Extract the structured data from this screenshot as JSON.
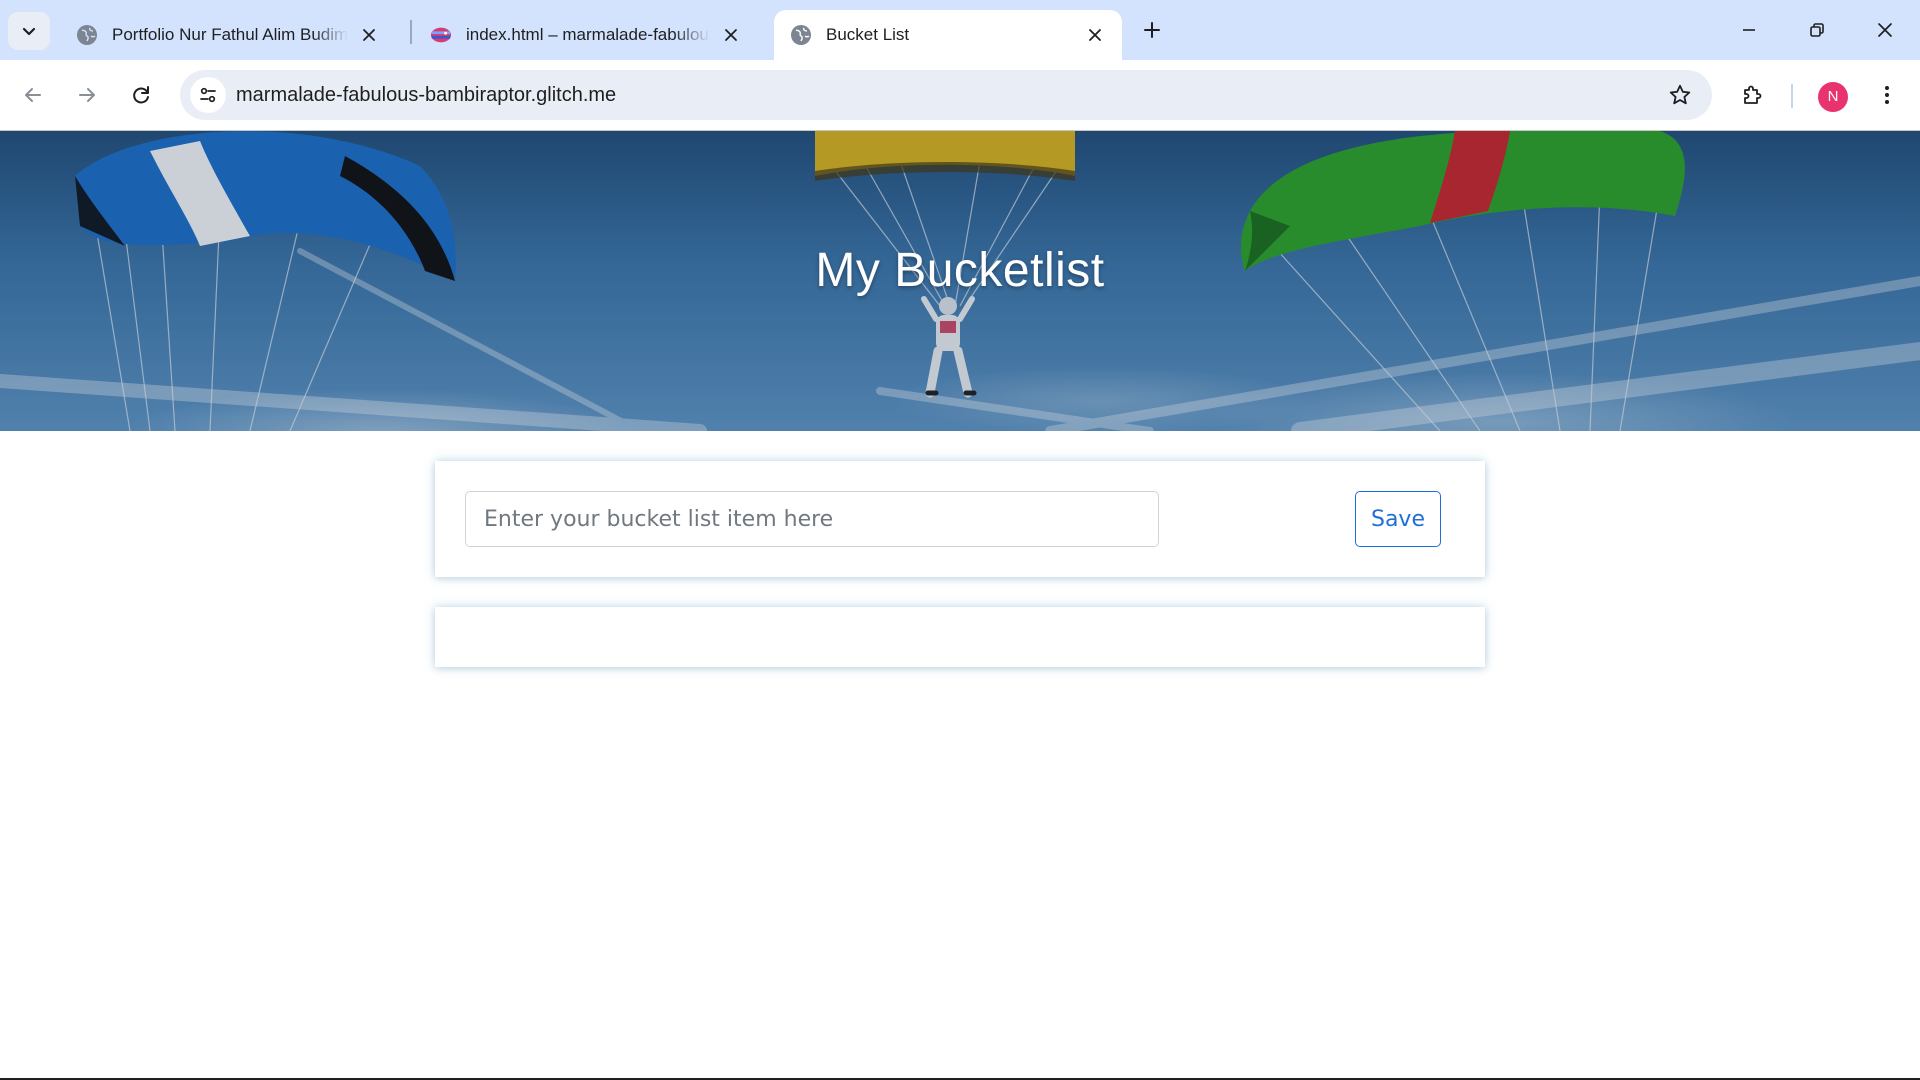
{
  "browser": {
    "tabs": [
      {
        "title": "Portfolio Nur Fathul Alim Budiman",
        "favicon": "globe-icon",
        "active": false
      },
      {
        "title": "index.html – marmalade-fabulous-bambiraptor",
        "favicon": "glitch-fish-icon",
        "active": false
      },
      {
        "title": "Bucket List",
        "favicon": "globe-icon",
        "active": true
      }
    ],
    "url": "marmalade-fabulous-bambiraptor.glitch.me",
    "profile_initial": "N",
    "colors": {
      "tabstrip": "#d3e3fd",
      "omnibox": "#e9eef6",
      "avatar": "#e8336f"
    }
  },
  "page": {
    "hero": {
      "title": "My Bucketlist"
    },
    "form": {
      "input_placeholder": "Enter your bucket list item here",
      "input_value": "",
      "save_label": "Save"
    },
    "list": {
      "items": []
    },
    "colors": {
      "primary": "#1f6fd8",
      "card_glow": "#6eaad2"
    }
  }
}
